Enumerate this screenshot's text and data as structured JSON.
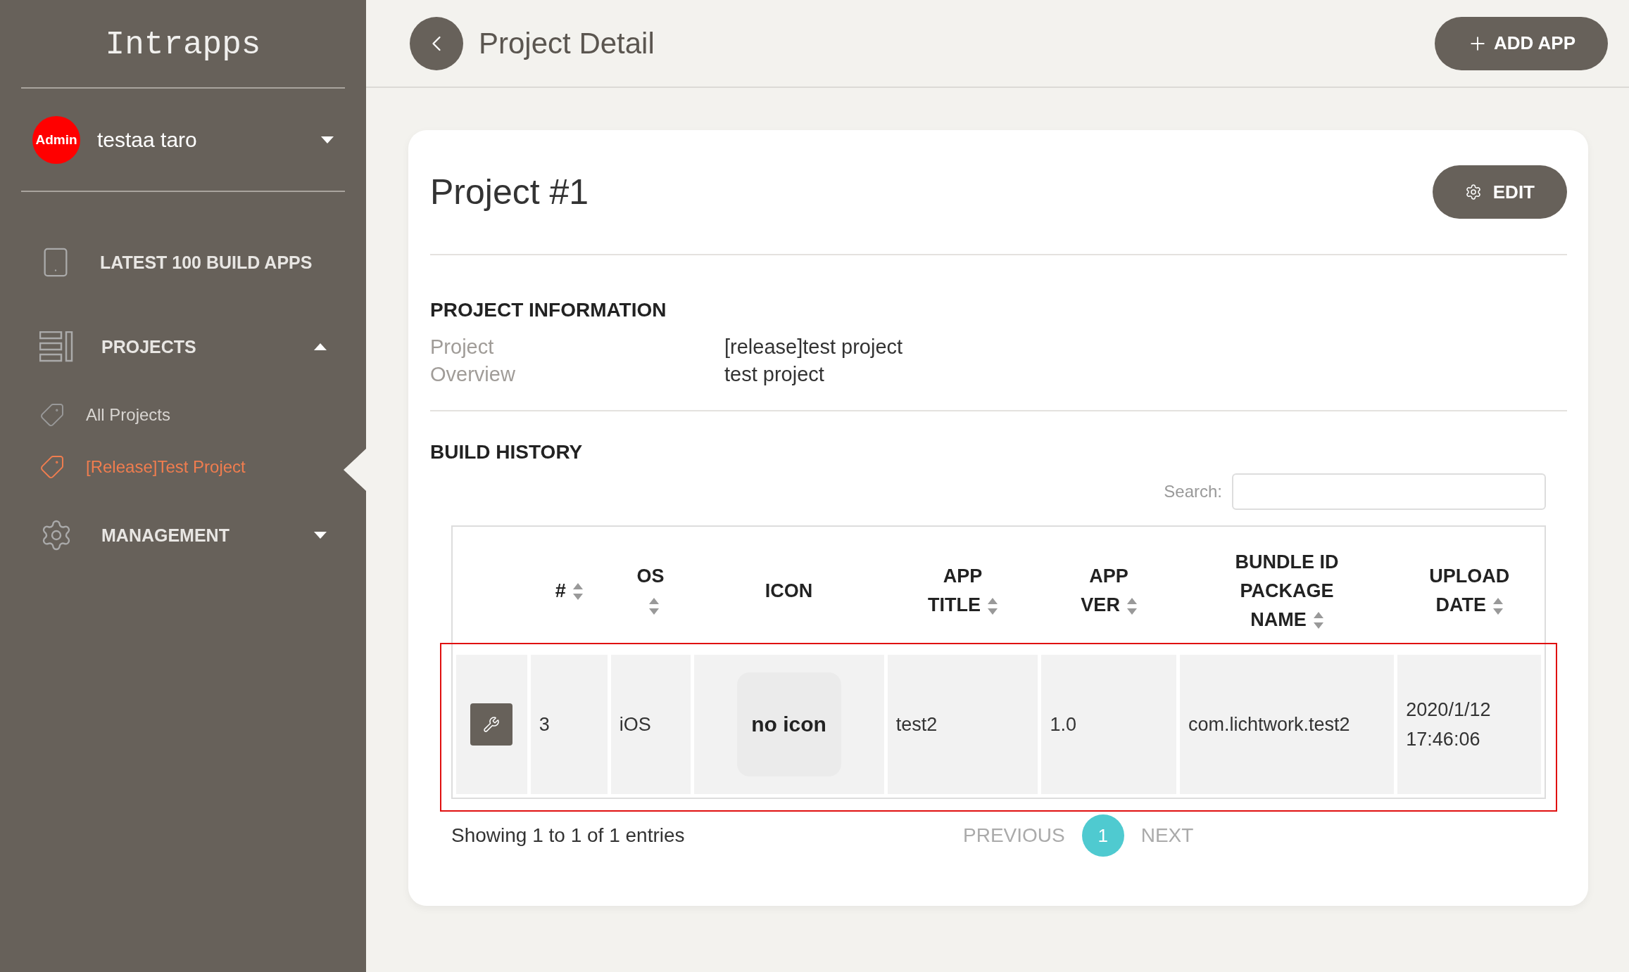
{
  "sidebar": {
    "brand": "Intrapps",
    "user": {
      "badge": "Admin",
      "name": "testaa taro",
      "expanded": false
    },
    "menu": [
      {
        "label": "LATEST 100 BUILD APPS",
        "kind": "link"
      },
      {
        "label": "PROJECTS",
        "kind": "group",
        "expanded": true,
        "children": [
          {
            "label": "All Projects",
            "selected": false
          },
          {
            "label": "[Release]Test Project",
            "selected": true
          }
        ]
      },
      {
        "label": "MANAGEMENT",
        "kind": "group",
        "expanded": false
      }
    ]
  },
  "header": {
    "title": "Project Detail",
    "add_button": "ADD APP"
  },
  "project": {
    "title": "Project #1",
    "edit_button": "EDIT",
    "info_heading": "PROJECT INFORMATION",
    "info": [
      {
        "label": "Project",
        "value": "[release]test project"
      },
      {
        "label": "Overview",
        "value": "test project"
      }
    ],
    "build_heading": "BUILD HISTORY",
    "search": {
      "label": "Search:"
    },
    "table": {
      "columns": [
        {
          "label": "#",
          "sortable": true
        },
        {
          "label": "OS",
          "sortable": true
        },
        {
          "label": "ICON",
          "sortable": false
        },
        {
          "label": "APP TITLE",
          "sortable": true
        },
        {
          "label": "APP VER",
          "sortable": true
        },
        {
          "label": "BUNDLE ID PACKAGE NAME",
          "sortable": true
        },
        {
          "label": "UPLOAD DATE",
          "sortable": true
        }
      ],
      "rows": [
        {
          "number": "3",
          "os": "iOS",
          "icon": "no icon",
          "app_title": "test2",
          "app_ver": "1.0",
          "bundle_id": "com.lichtwork.test2",
          "upload_date": "2020/1/12 17:46:06",
          "highlighted": true
        }
      ]
    },
    "footer": {
      "info": "Showing 1 to 1 of 1 entries",
      "previous": {
        "label": "PREVIOUS",
        "disabled": true
      },
      "pages": [
        {
          "label": "1",
          "selected": true
        }
      ],
      "next": {
        "label": "NEXT",
        "disabled": true
      }
    }
  }
}
